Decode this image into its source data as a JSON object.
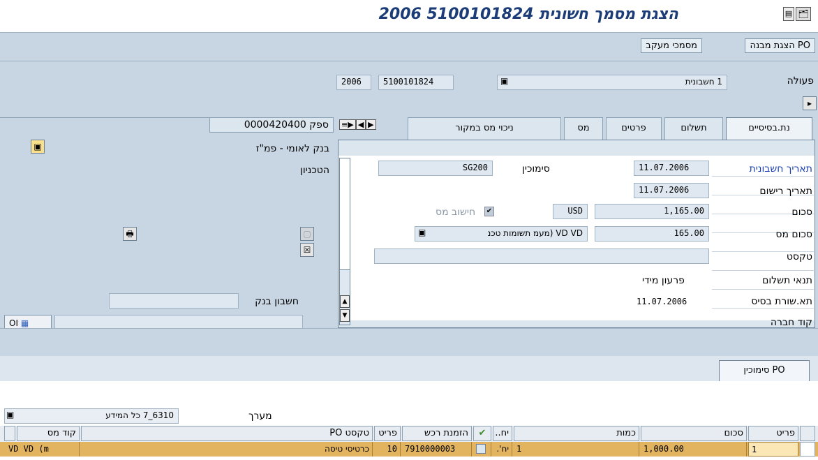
{
  "title": "הצגת מסמך חשונית 5100101824 2006",
  "toolbar": {
    "po_structure": "הצגת מבנה PO",
    "tracking_docs": "מסמכי מעקב"
  },
  "header": {
    "action_label": "פעולה",
    "action_value": "1 חשבונית",
    "doc_number": "5100101824",
    "year": "2006"
  },
  "vendor": {
    "vendor_label": "ספק 0000420400",
    "bank_name": "בנק לאומי  - פמ\"ז",
    "technion": "הטכניון",
    "bank_account_label": "חשבון בנק",
    "oi_label": "OI"
  },
  "tabs": [
    "נת.בסיסיים",
    "תשלום",
    "פרטים",
    "מס",
    "ניכוי מס במקור"
  ],
  "form": {
    "invoice_date_label": "תאריך חשבונית",
    "invoice_date": "11.07.2006",
    "posting_date_label": "תאריך רישום",
    "posting_date": "11.07.2006",
    "amount_label": "סכום",
    "amount": "1,165.00",
    "currency": "USD",
    "calc_tax_label": "חישוב מס",
    "tax_amount_label": "סכום מס",
    "tax_amount": "165.00",
    "tax_code": "VD VD (מעמ תשומות טכנ",
    "text_label": "טקסט",
    "payment_terms_label": "תנאי תשלום",
    "payment_terms": "פרעון מידי",
    "baseline_label": "תא.שורת בסיס",
    "baseline_date": "11.07.2006",
    "company_code_label": "קוד חברה",
    "reference_label": "סימוכין",
    "reference": "SG200"
  },
  "po_tab": "PO סימוכין",
  "layout_row": {
    "layout_label": "מערך",
    "layout_value": "6310_7 כל המידע"
  },
  "table": {
    "headers": {
      "item": "פריט",
      "amount": "סכום",
      "quantity": "כמות",
      "unit": "יח..",
      "po": "הזמנת רכש",
      "po_item": "פריט",
      "po_text": "טקסט PO",
      "tax_code": "קוד מס"
    },
    "row": {
      "item": "1",
      "amount": "1,000.00",
      "quantity": "1",
      "unit": "יח'.",
      "po": "7910000003",
      "po_item": "10",
      "po_text": "כרטיסי טיסה",
      "tax_code": "VD VD (m"
    }
  },
  "colors": {
    "title": "#1c3c78",
    "bg_band": "#c8d6e4",
    "row_highlight": "#e2b460"
  }
}
